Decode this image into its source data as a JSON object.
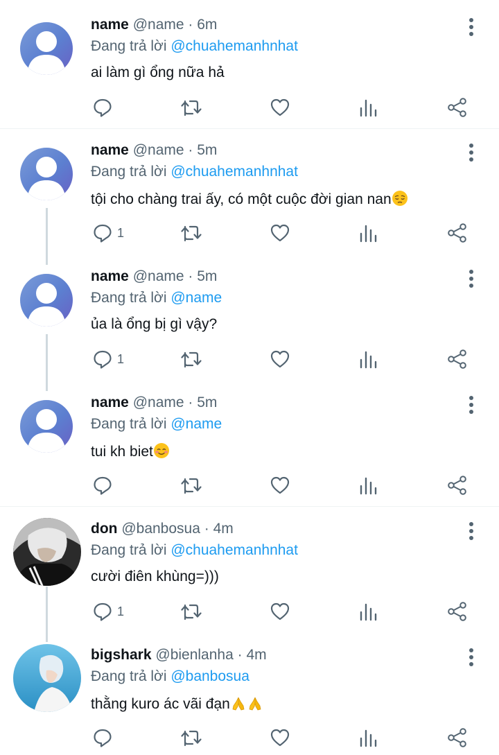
{
  "reply_prefix": "Đang trả lời",
  "tweets": [
    {
      "name": "name",
      "meta": "@name · 6m",
      "mention": "@chuahemanhnhat",
      "text": "ai làm gì ổng nữa hả",
      "reply_count": ""
    },
    {
      "name": "name",
      "meta": "@name · 5m",
      "mention": "@chuahemanhnhat",
      "text": "tội cho chàng trai ấy, có một cuộc đời gian nan",
      "emoji": "pensive-face",
      "reply_count": "1"
    },
    {
      "name": "name",
      "meta": "@name · 5m",
      "mention": "@name",
      "text": "ủa là ổng bị gì vậy?",
      "reply_count": "1"
    },
    {
      "name": "name",
      "meta": "@name · 5m",
      "mention": "@name",
      "text": "tui kh biet",
      "emoji": "smiling-face",
      "reply_count": ""
    },
    {
      "name": "don",
      "meta": "@banbosua · 4m",
      "mention": "@chuahemanhnhat",
      "text": "cười điên khùng=)))",
      "reply_count": "1"
    },
    {
      "name": "bigshark",
      "meta": "@bienlanha · 4m",
      "mention": "@banbosua",
      "text": "thằng kuro ác vãi đạn",
      "emoji": "folded-hands",
      "reply_count": ""
    }
  ],
  "colors": {
    "accent": "#1d9bf0",
    "secondary": "#536471",
    "thread_line": "#cfd9de",
    "default_avatar": "#6a86d6"
  }
}
